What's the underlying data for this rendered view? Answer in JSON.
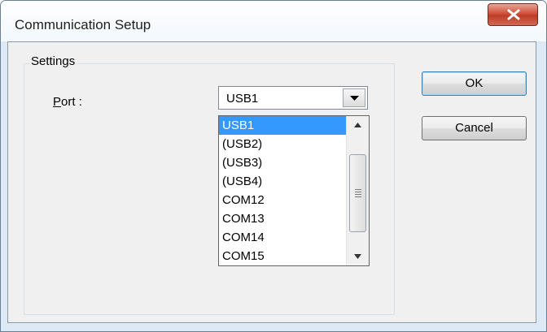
{
  "window": {
    "title": "Communication Setup"
  },
  "settings": {
    "group_label": "Settings",
    "port_label": "Port :",
    "port_value": "USB1",
    "port_options": [
      "USB1",
      "(USB2)",
      "(USB3)",
      "(USB4)",
      "COM12",
      "COM13",
      "COM14",
      "COM15"
    ]
  },
  "buttons": {
    "ok": "OK",
    "cancel": "Cancel"
  },
  "icons": {
    "close": "close-icon",
    "dropdown": "chevron-down-icon",
    "scroll_up": "scroll-up-arrow-icon",
    "scroll_down": "scroll-down-arrow-icon"
  },
  "colors": {
    "selection": "#3399ff",
    "close_button": "#c7432f",
    "titlebar": "#eef5fb"
  }
}
